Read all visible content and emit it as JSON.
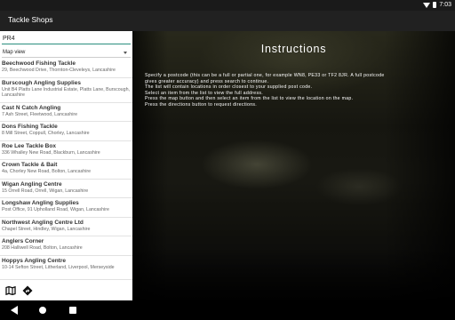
{
  "status_bar": {
    "time": "7:03"
  },
  "app_bar": {
    "title": "Tackle Shops"
  },
  "search": {
    "value": "PR4"
  },
  "view_select": {
    "selected": "Map view"
  },
  "shops": [
    {
      "name": "Beechwood Fishing Tackle",
      "address": "29, Beechwood Drive, Thornton-Cleveleys, Lancashire"
    },
    {
      "name": "Burscough Angling Supplies",
      "address": "Unit B4 Platts Lane Industrial Estate, Platts Lane, Burscough, Lancashire"
    },
    {
      "name": "Cast N Catch Angling",
      "address": "7 Ash Street, Fleetwood, Lancashire"
    },
    {
      "name": "Dons Fishing Tackle",
      "address": "8 Mill Street, Coppull, Chorley, Lancashire"
    },
    {
      "name": "Roe Lee Tackle Box",
      "address": "336 Whalley New Road, Blackburn, Lancashire"
    },
    {
      "name": "Crown Tackle & Bait",
      "address": "4a, Chorley New Road, Bolton, Lancashire"
    },
    {
      "name": "Wigan Angling Centre",
      "address": "15 Orrell Road, Orrell, Wigan, Lancashire"
    },
    {
      "name": "Longshaw Angling Supplies",
      "address": "Post Office, 91 Upholland Road, Wigan, Lancashire"
    },
    {
      "name": "Northwest Angling Centre Ltd",
      "address": "Chapel Street, Hindley, Wigan, Lancashire"
    },
    {
      "name": "Anglers Corner",
      "address": "208 Halliwell Road, Bolton, Lancashire"
    },
    {
      "name": "Hoppys Angling Centre",
      "address": "10-14 Sefton Street, Litherland, Liverpool, Merseyside"
    }
  ],
  "bottom_bar": {
    "map_icon": "map-icon",
    "directions_icon": "directions-icon"
  },
  "instructions": {
    "title": "Instructions",
    "lines": [
      "Specify a postcode (this can be a full or partial one, for example WN8, PE33 or TF2 8JR. A full postcode",
      "gives greater accuracy) and press search to continue.",
      "The list will contain locations in order closest to your supplied post code.",
      "Select an item from the list to view the full address.",
      "Press the map button and then select an item from the list to view the location on the map.",
      "Press the directions button to request directions."
    ]
  },
  "colors": {
    "accent": "#2a8f7e",
    "app_bar": "#212121",
    "status_bar": "#1a1a1a"
  }
}
